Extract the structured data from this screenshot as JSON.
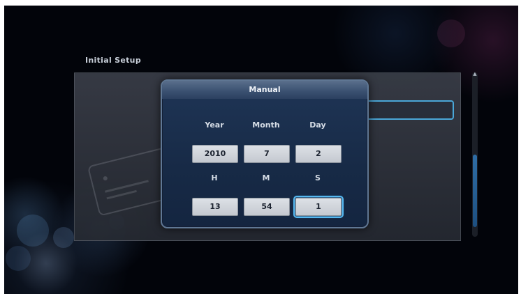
{
  "screen": {
    "title": "Initial Setup"
  },
  "dialog": {
    "title": "Manual",
    "date_labels": [
      "Year",
      "Month",
      "Day"
    ],
    "date_values": [
      "2010",
      "7",
      "2"
    ],
    "time_labels": [
      "H",
      "M",
      "S"
    ],
    "time_values": [
      "13",
      "54",
      "1"
    ],
    "focused_field": "S"
  },
  "colors": {
    "focus": "#56b8f0",
    "dialog_bg": "#1f3556",
    "value_box": "#dde1e6"
  },
  "icons": {
    "scroll_up": "scroll-up-arrow-icon",
    "card": "card-graphic-icon"
  }
}
